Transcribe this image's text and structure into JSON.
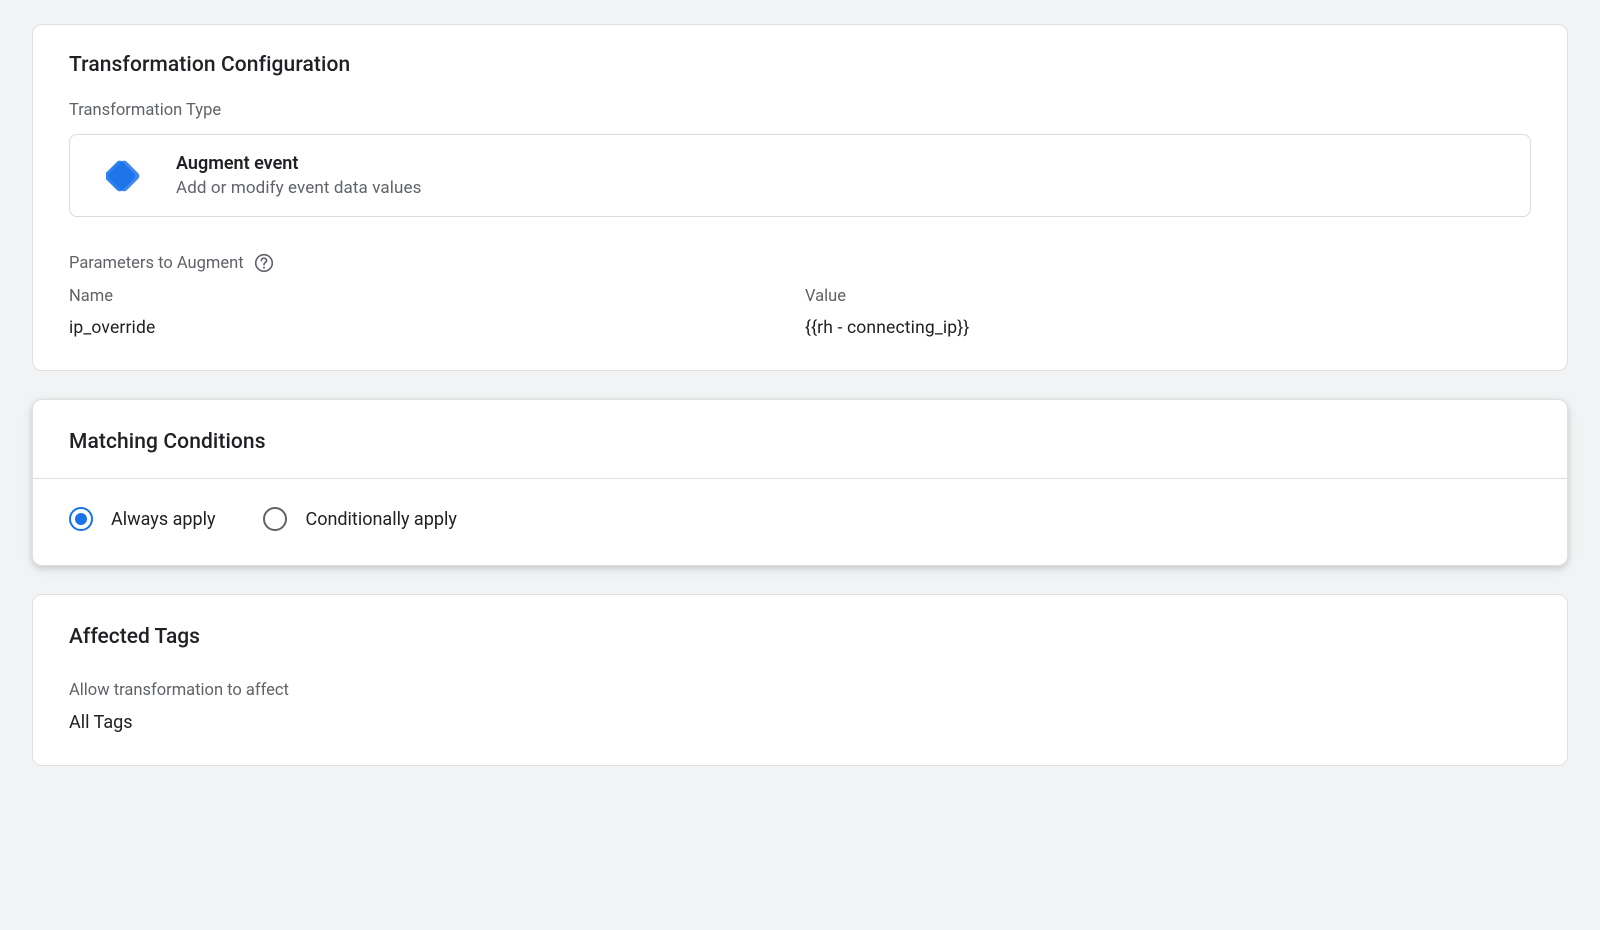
{
  "transformation": {
    "title": "Transformation Configuration",
    "type_label": "Transformation Type",
    "type_name": "Augment event",
    "type_description": "Add or modify event data values",
    "params_label": "Parameters to Augment",
    "params": {
      "name_header": "Name",
      "value_header": "Value",
      "name": "ip_override",
      "value": "{{rh - connecting_ip}}"
    }
  },
  "matching": {
    "title": "Matching Conditions",
    "options": {
      "always": "Always apply",
      "conditional": "Conditionally apply"
    },
    "selected": "always"
  },
  "affected": {
    "title": "Affected Tags",
    "allow_label": "Allow transformation to affect",
    "value": "All Tags"
  }
}
